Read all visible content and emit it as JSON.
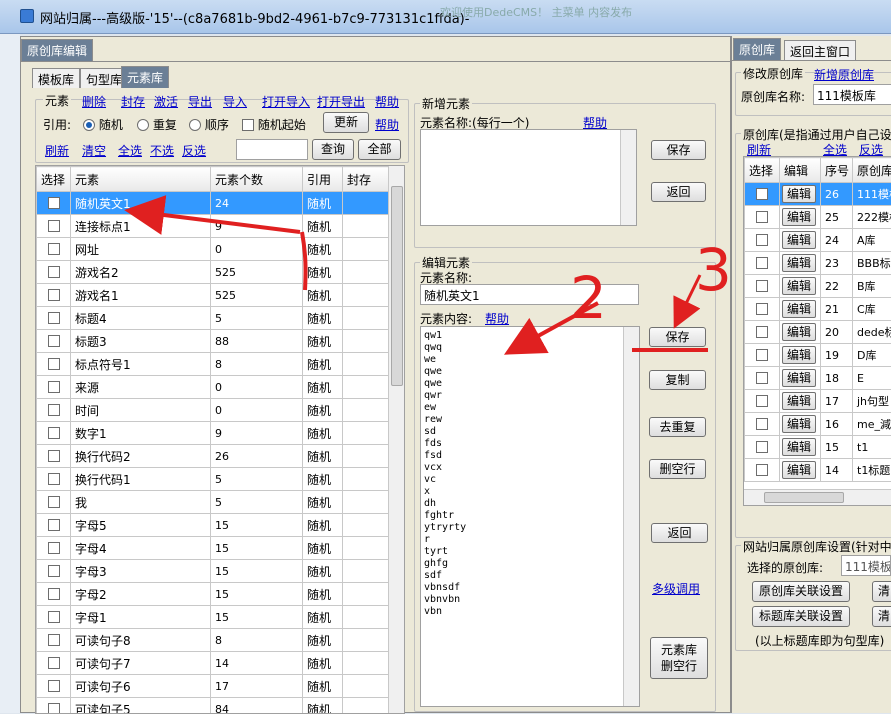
{
  "window": {
    "title": "网站归属---高级版-'15'--(c8a7681b-9bd2-4961-b7c9-773131c1ffda)-",
    "bg_nav": "欢迎使用DedeCMS！      主菜单     内容发布"
  },
  "top_tabs": {
    "main": "原创库编辑"
  },
  "sub_tabs": [
    "模板库",
    "句型库",
    "元素库"
  ],
  "toolbar": {
    "section_label": "元素",
    "delete": "删除",
    "seal": "封存",
    "activate": "激活",
    "export": "导出",
    "import": "导入",
    "open_import": "打开导入",
    "open_export": "打开导出",
    "help": "帮助",
    "ref_label": "引用:",
    "opt_random": "随机",
    "opt_repeat": "重复",
    "opt_order": "顺序",
    "opt_random_start": "随机起始",
    "update": "更新",
    "help2": "帮助",
    "refresh": "刷新",
    "clear": "清空",
    "select_all": "全选",
    "deselect": "不选",
    "invert": "反选",
    "search_value": "",
    "query": "查询",
    "all": "全部"
  },
  "element_table": {
    "headers": [
      "选择",
      "元素",
      "元素个数",
      "引用",
      "封存"
    ],
    "rows": [
      {
        "name": "随机英文1",
        "count": "24",
        "ref": "随机"
      },
      {
        "name": "连接标点1",
        "count": "9",
        "ref": "随机"
      },
      {
        "name": "网址",
        "count": "0",
        "ref": "随机"
      },
      {
        "name": "游戏名2",
        "count": "525",
        "ref": "随机"
      },
      {
        "name": "游戏名1",
        "count": "525",
        "ref": "随机"
      },
      {
        "name": "标题4",
        "count": "5",
        "ref": "随机"
      },
      {
        "name": "标题3",
        "count": "88",
        "ref": "随机"
      },
      {
        "name": "标点符号1",
        "count": "8",
        "ref": "随机"
      },
      {
        "name": "来源",
        "count": "0",
        "ref": "随机"
      },
      {
        "name": "时间",
        "count": "0",
        "ref": "随机"
      },
      {
        "name": "数字1",
        "count": "9",
        "ref": "随机"
      },
      {
        "name": "换行代码2",
        "count": "26",
        "ref": "随机"
      },
      {
        "name": "换行代码1",
        "count": "5",
        "ref": "随机"
      },
      {
        "name": "我",
        "count": "5",
        "ref": "随机"
      },
      {
        "name": "字母5",
        "count": "15",
        "ref": "随机"
      },
      {
        "name": "字母4",
        "count": "15",
        "ref": "随机"
      },
      {
        "name": "字母3",
        "count": "15",
        "ref": "随机"
      },
      {
        "name": "字母2",
        "count": "15",
        "ref": "随机"
      },
      {
        "name": "字母1",
        "count": "15",
        "ref": "随机"
      },
      {
        "name": "可读句子8",
        "count": "8",
        "ref": "随机"
      },
      {
        "name": "可读句子7",
        "count": "14",
        "ref": "随机"
      },
      {
        "name": "可读句子6",
        "count": "17",
        "ref": "随机"
      },
      {
        "name": "可读句子5",
        "count": "84",
        "ref": "随机"
      }
    ]
  },
  "new_element": {
    "title": "新增元素",
    "name_label": "元素名称:(每行一个)",
    "help": "帮助",
    "save": "保存",
    "back": "返回"
  },
  "edit_element": {
    "title": "编辑元素",
    "name_label": "元素名称:",
    "name_value": "随机英文1",
    "content_label": "元素内容:",
    "help": "帮助",
    "content": "qw1\nqwq\nwe\nqwe\nqwe\nqwr\new\nrew\nsd\nfds\nfsd\nvcx\nvc\nx\ndh\nfghtr\nytryrty\nr\ntyrt\nghfg\nsdf\nvbnsdf\nvbnvbn\nvbn",
    "save": "保存",
    "copy": "复制",
    "dedupe": "去重复",
    "delete_empty": "删空行",
    "back": "返回",
    "multi_call": "多级调用",
    "lib_delete_empty_1": "元素库",
    "lib_delete_empty_2": "删空行"
  },
  "annotations": {
    "n1": "1",
    "n2": "2",
    "n3": "3"
  },
  "right": {
    "tabs": [
      "原创库",
      "返回主窗口"
    ],
    "modify_label": "修改原创库",
    "new_link": "新增原创库",
    "name_label": "原创库名称:",
    "name_value": "111模板库",
    "desc": "原创库(是指通过用户自己设",
    "refresh": "刷新",
    "select_all": "全选",
    "invert": "反选",
    "headers": [
      "选择",
      "编辑",
      "序号",
      "原创库名称"
    ],
    "edit_label": "编辑",
    "rows": [
      {
        "no": "26",
        "name": "111模板"
      },
      {
        "no": "25",
        "name": "222模板"
      },
      {
        "no": "24",
        "name": "A库"
      },
      {
        "no": "23",
        "name": "BBB标题"
      },
      {
        "no": "22",
        "name": "B库"
      },
      {
        "no": "21",
        "name": "C库"
      },
      {
        "no": "20",
        "name": "dede标"
      },
      {
        "no": "19",
        "name": "D库"
      },
      {
        "no": "18",
        "name": "E"
      },
      {
        "no": "17",
        "name": "jh句型"
      },
      {
        "no": "16",
        "name": "me_減的"
      },
      {
        "no": "15",
        "name": "t1"
      },
      {
        "no": "14",
        "name": "t1标题"
      }
    ],
    "site_settings": "网站归属原创库设置(针对中",
    "selected_label": "选择的原创库:",
    "selected_value": "111模板",
    "assoc_btn": "原创库关联设置",
    "title_assoc_btn": "标题库关联设置",
    "clear1": "清",
    "clear2": "清",
    "note": "(以上标题库即为句型库)"
  },
  "colors": {
    "selection": "#3399ff",
    "annotation": "#e02020",
    "link": "#0000cc"
  }
}
